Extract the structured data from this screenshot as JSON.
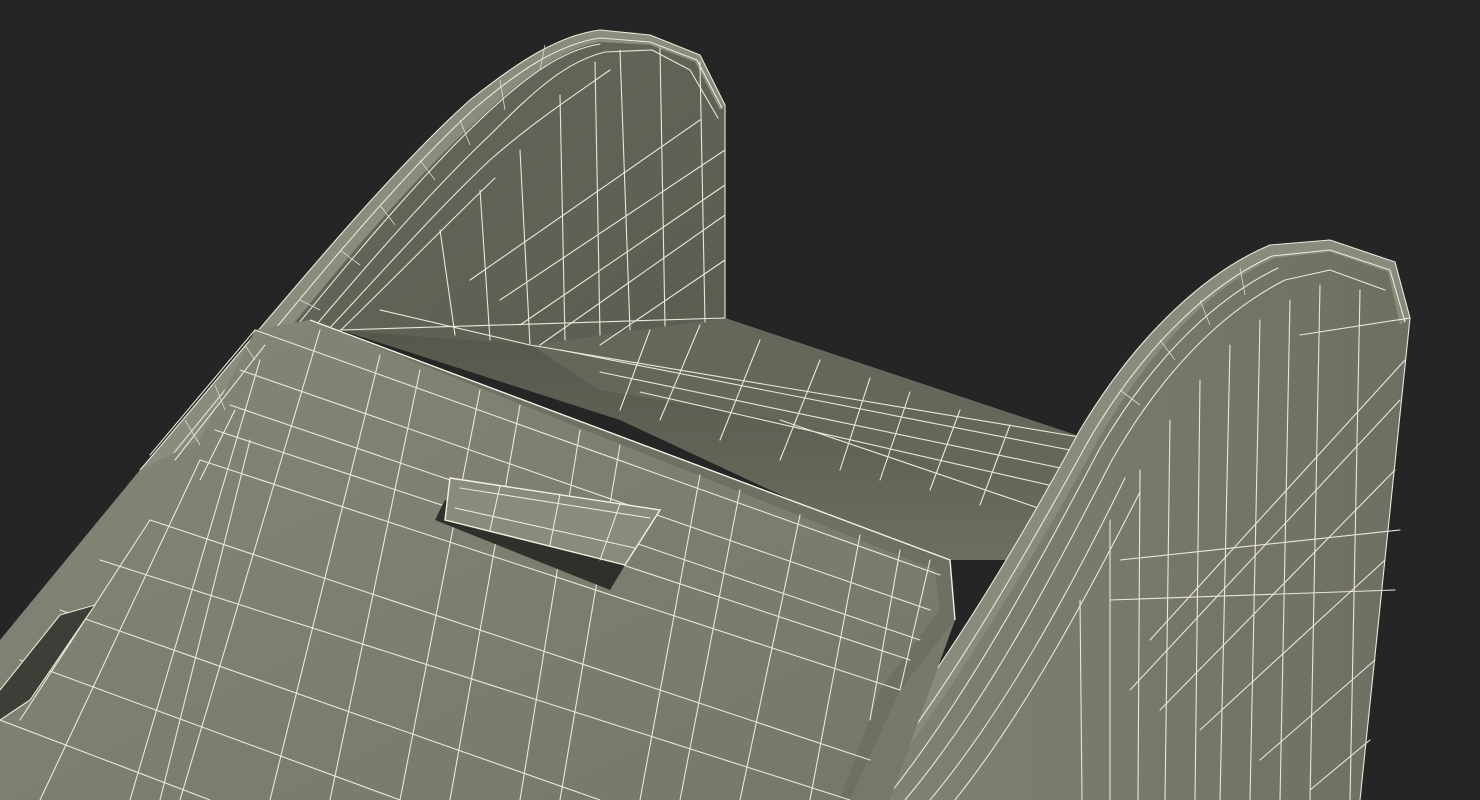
{
  "scene": {
    "background_color": "#252525",
    "surface_color": "#7d7e70",
    "surface_shadow_color": "#5d5e52",
    "wire_color": "#e9e8d9",
    "object": "wireframe-3d-model-render"
  }
}
